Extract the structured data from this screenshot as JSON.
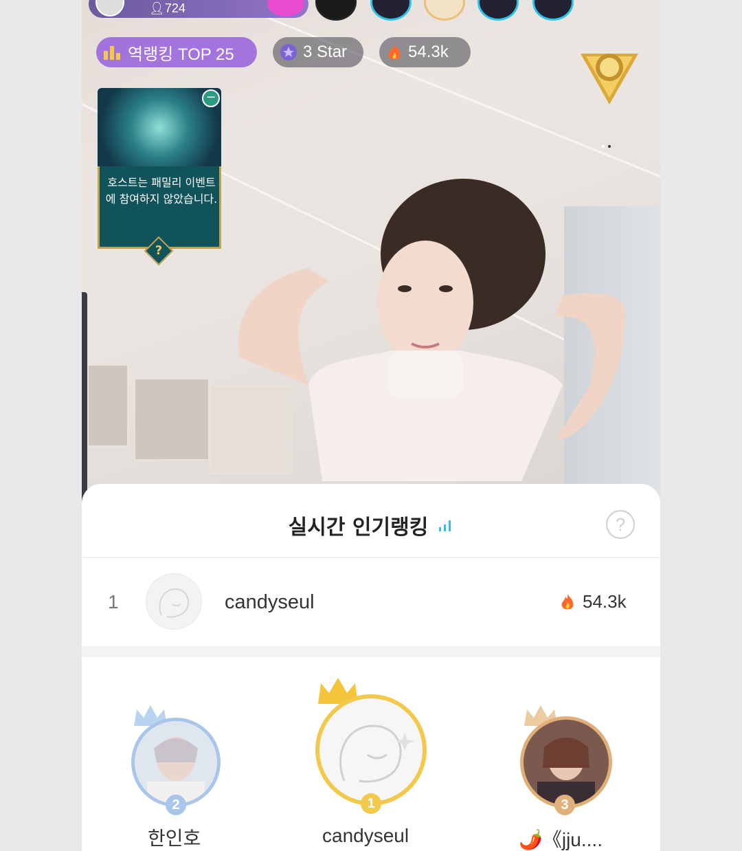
{
  "top_bar": {
    "viewer_count": "724"
  },
  "badges": {
    "ranking_label": "역랭킹 TOP 25",
    "star_label": "3 Star",
    "fire_label": "54.3k"
  },
  "event_card": {
    "message": "호스트는 패밀리 이벤트에 참여하지 않았습니다.",
    "help_symbol": "?",
    "close_symbol": "−"
  },
  "ranking_panel": {
    "title": "실시간 인기랭킹",
    "help_symbol": "?",
    "my_entry": {
      "rank": "1",
      "name": "candyseul",
      "score": "54.3k"
    },
    "podium": [
      {
        "rank": "2",
        "name": "한인호"
      },
      {
        "rank": "1",
        "name": "candyseul"
      },
      {
        "rank": "3",
        "name": "🌶️《jju...."
      }
    ]
  },
  "colors": {
    "rank_badge": "#9660dc",
    "accent_cyan": "#38c0e0",
    "gold": "#f2c94c",
    "silver_blue": "#a9c6ea",
    "bronze": "#e0b07a"
  }
}
